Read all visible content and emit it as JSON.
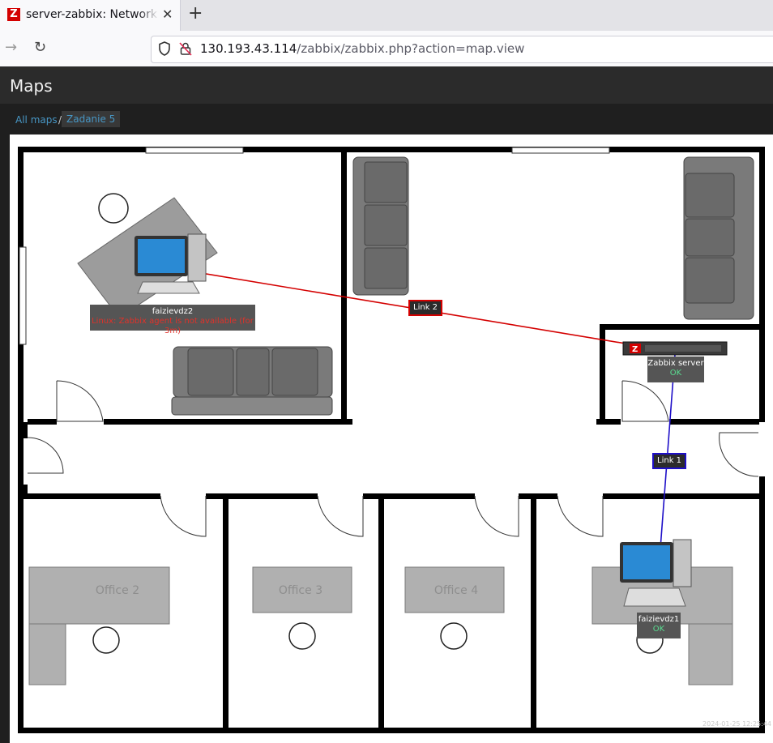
{
  "browser": {
    "tab_title": "server-zabbix: Network maps",
    "favicon_letter": "Z",
    "url_host": "130.193.43.114",
    "url_path": "/zabbix/zabbix.php?action=map.view"
  },
  "page": {
    "title": "Maps"
  },
  "breadcrumbs": {
    "root": "All maps",
    "separator": "/",
    "current": "Zadanie 5"
  },
  "map": {
    "offices": [
      "Office 2",
      "Office 3",
      "Office 4"
    ],
    "hosts": [
      {
        "name": "faizievdz2",
        "status": "Linux: Zabbix agent is not available (for 3m)"
      },
      {
        "name": "Zabbix server",
        "status": "OK"
      },
      {
        "name": "faizievdz1",
        "status": "OK"
      }
    ],
    "links": [
      {
        "label": "Link 2",
        "color": "#d40000"
      },
      {
        "label": "Link 1",
        "color": "#1e0fc8"
      }
    ],
    "timestamp": "2024-01-25 12:25:44"
  },
  "colors": {
    "problem": "#e0322a",
    "ok": "#59db8f",
    "accent": "#4796c4"
  }
}
